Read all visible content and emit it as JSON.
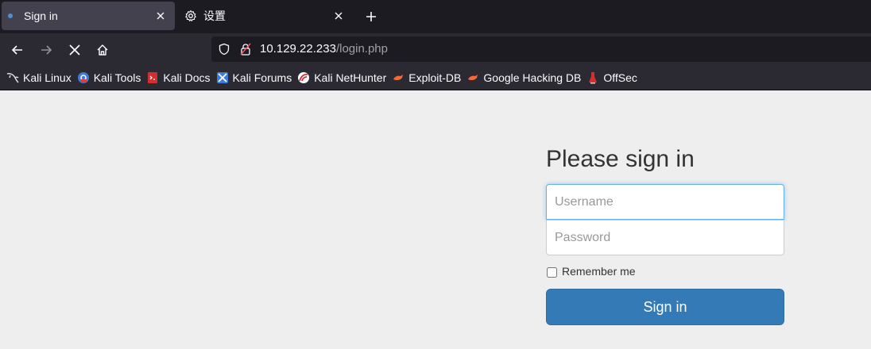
{
  "browser": {
    "tabs": [
      {
        "title": "Sign in",
        "active": true
      },
      {
        "title": "设置",
        "active": false
      }
    ],
    "new_tab_label": "+",
    "url": {
      "host": "10.129.22.233",
      "path": "/login.php"
    },
    "bookmarks": [
      {
        "label": "Kali Linux",
        "icon": "kali-dragon-icon"
      },
      {
        "label": "Kali Tools",
        "icon": "kali-tools-icon"
      },
      {
        "label": "Kali Docs",
        "icon": "kali-docs-icon"
      },
      {
        "label": "Kali Forums",
        "icon": "kali-forums-icon"
      },
      {
        "label": "Kali NetHunter",
        "icon": "nethunter-icon"
      },
      {
        "label": "Exploit-DB",
        "icon": "exploit-db-icon"
      },
      {
        "label": "Google Hacking DB",
        "icon": "ghdb-icon"
      },
      {
        "label": "OffSec",
        "icon": "offsec-icon"
      }
    ]
  },
  "login": {
    "heading": "Please sign in",
    "username_placeholder": "Username",
    "password_placeholder": "Password",
    "remember_label": "Remember me",
    "submit_label": "Sign in"
  },
  "colors": {
    "primary_button": "#337ab7",
    "page_background": "#eeeeee",
    "focus_ring": "#66afe9"
  }
}
